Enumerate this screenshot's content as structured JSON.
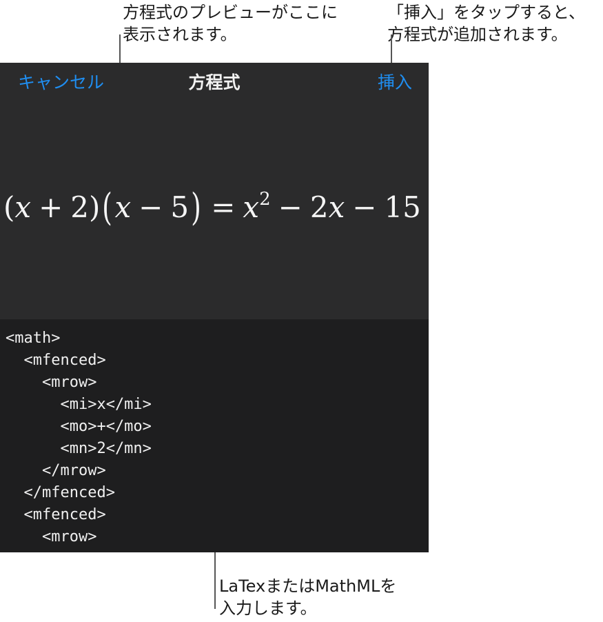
{
  "callouts": {
    "preview": [
      "方程式のプレビューがここに",
      "表示されます。"
    ],
    "insert": [
      "「挿入」をタップすると、",
      "方程式が追加されます。"
    ],
    "input": [
      "LaTexまたはMathMLを",
      "入力します。"
    ]
  },
  "nav": {
    "cancel_label": "キャンセル",
    "title": "方程式",
    "insert_label": "挿入"
  },
  "equation": {
    "lhs_open": "(",
    "lhs_var": "x",
    "lhs_plus": "+",
    "lhs_num": "2",
    "lhs_close": ")",
    "mid_open": "(",
    "mid_var": "x",
    "mid_minus": "−",
    "mid_num": "5",
    "mid_close": ")",
    "equals": "=",
    "rhs_var": "x",
    "rhs_exp": "2",
    "rhs_minus1": "−",
    "rhs_term": "2",
    "rhs_term_var": "x",
    "rhs_minus2": "−",
    "rhs_const": "15"
  },
  "editor": {
    "lines": [
      "<math>",
      "  <mfenced>",
      "    <mrow>",
      "      <mi>x</mi>",
      "      <mo>+</mo>",
      "      <mn>2</mn>",
      "    </mrow>",
      "  </mfenced>",
      "  <mfenced>",
      "    <mrow>"
    ]
  },
  "colors": {
    "accent": "#1f8ef1",
    "panel": "#2b2b2c",
    "editor_bg": "#1e1e1f"
  }
}
